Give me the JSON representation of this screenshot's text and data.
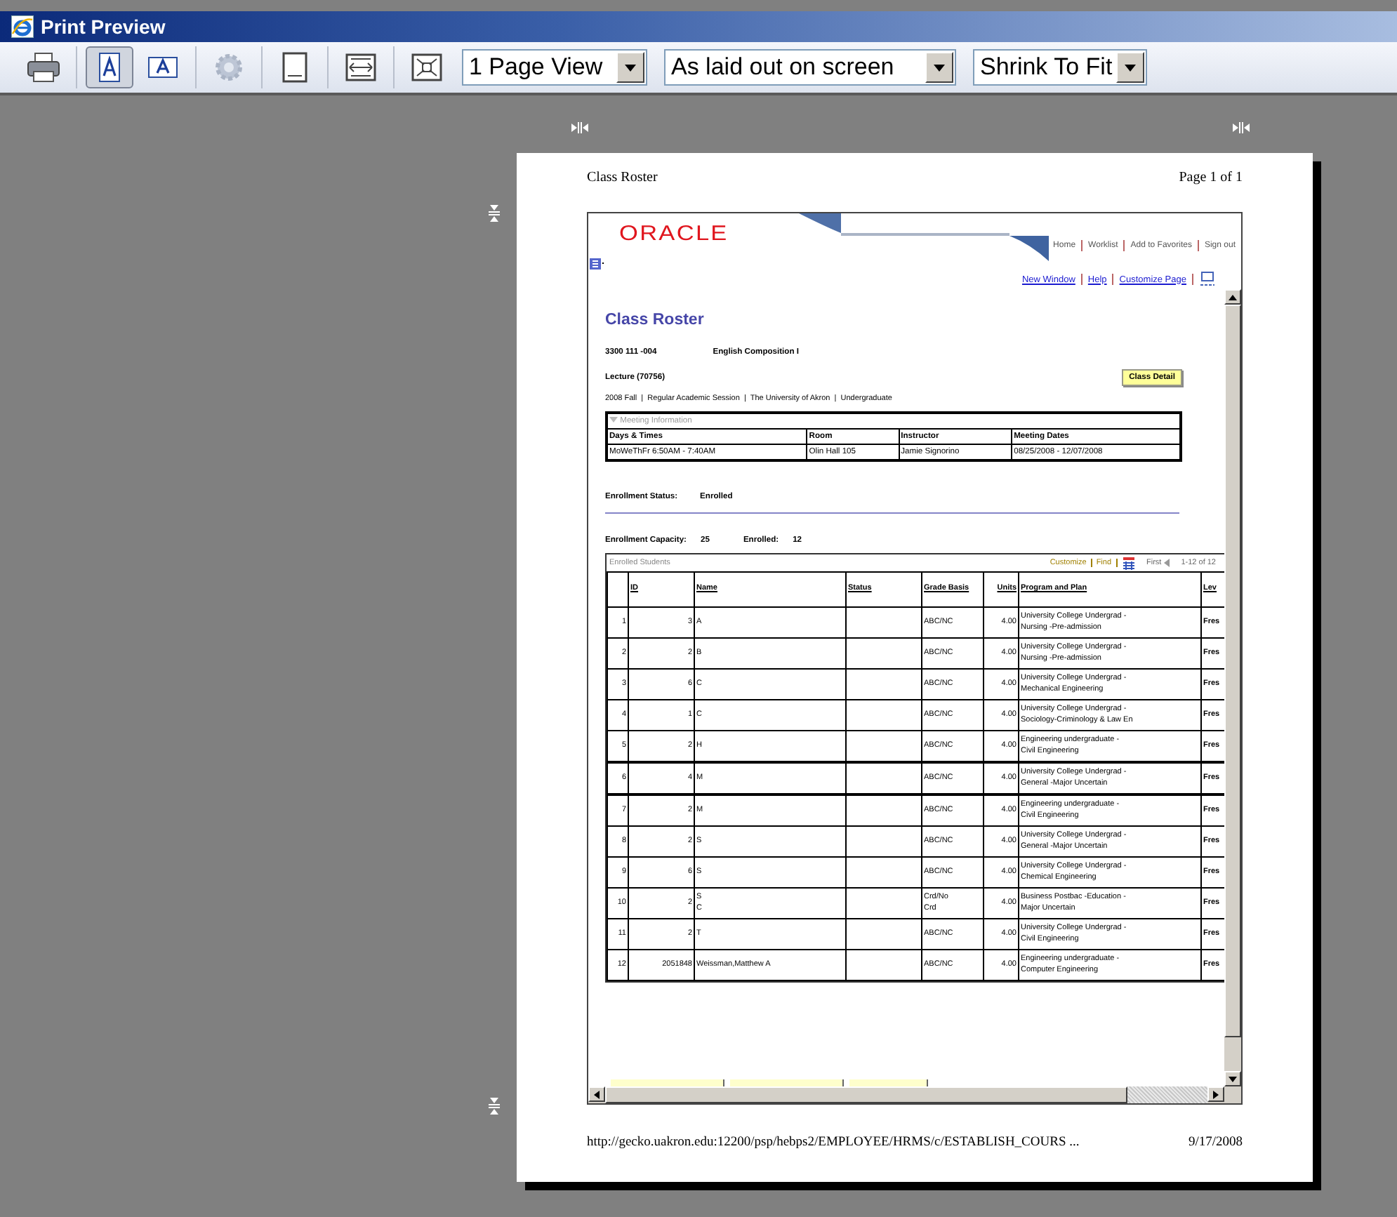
{
  "window": {
    "title": "Print Preview"
  },
  "toolbar": {
    "buttons": [
      {
        "kind": "print",
        "selected": false,
        "disabled": false
      },
      {
        "kind": "portrait",
        "selected": true,
        "disabled": false
      },
      {
        "kind": "landscape",
        "selected": false,
        "disabled": false
      },
      {
        "kind": "setup",
        "selected": false,
        "disabled": true
      },
      {
        "kind": "single-page",
        "selected": false,
        "disabled": false
      },
      {
        "kind": "page-width",
        "selected": false,
        "disabled": false
      },
      {
        "kind": "full-page",
        "selected": false,
        "disabled": false
      }
    ],
    "dropdowns": [
      {
        "value": "1 Page View"
      },
      {
        "value": "As laid out on screen"
      },
      {
        "value": "Shrink To Fit"
      }
    ]
  },
  "page": {
    "header_left": "Class Roster",
    "header_right": "Page 1 of 1",
    "footer_url": "http://gecko.uakron.edu:12200/psp/hebps2/EMPLOYEE/HRMS/c/ESTABLISH_COURS ...",
    "footer_date": "9/17/2008",
    "screen": {
      "logo": "ORACLE",
      "nav": [
        "Home",
        "Worklist",
        "Add to Favorites",
        "Sign out"
      ],
      "links": [
        "New Window",
        "Help",
        "Customize Page"
      ],
      "title": "Class Roster",
      "course_code": "3300 111 -004",
      "course_name": "English Composition I",
      "section": "Lecture (70756)",
      "detail_button": "Class Detail",
      "term_line": "2008 Fall  |  Regular Academic Session  |  The University of Akron  |  Undergraduate",
      "meeting": {
        "title": "Meeting Information",
        "columns": [
          "Days & Times",
          "Room",
          "Instructor",
          "Meeting Dates"
        ],
        "row": [
          "MoWeThFr 6:50AM - 7:40AM",
          "Olin Hall 105",
          "Jamie Signorino",
          "08/25/2008 - 12/07/2008"
        ]
      },
      "status_label": "Enrollment Status:",
      "status_value": "Enrolled",
      "capacity_label": "Enrollment Capacity:",
      "capacity_value": "25",
      "enrolled_label": "Enrolled:",
      "enrolled_value": "12",
      "grid": {
        "title": "Enrolled Students",
        "customize": "Customize",
        "find": "Find",
        "first": "First",
        "range": "1-12 of 12",
        "columns": [
          "ID",
          "Name",
          "Status",
          "Grade Basis",
          "Units",
          "Program and Plan",
          "Lev"
        ],
        "rows": [
          {
            "num": "1",
            "id": "3",
            "name": "A",
            "grade": "ABC/NC",
            "units": "4.00",
            "program": "University College Undergrad -\nNursing -Pre-admission",
            "level": "Fres"
          },
          {
            "num": "2",
            "id": "2",
            "name": "B",
            "grade": "ABC/NC",
            "units": "4.00",
            "program": "University College Undergrad -\nNursing -Pre-admission",
            "level": "Fres"
          },
          {
            "num": "3",
            "id": "6",
            "name": "C",
            "grade": "ABC/NC",
            "units": "4.00",
            "program": "University College Undergrad -\nMechanical Engineering",
            "level": "Fres"
          },
          {
            "num": "4",
            "id": "1",
            "name": "C",
            "grade": "ABC/NC",
            "units": "4.00",
            "program": "University College Undergrad -\nSociology-Criminology & Law En",
            "level": "Fres"
          },
          {
            "num": "5",
            "id": "2",
            "name": "H",
            "grade": "ABC/NC",
            "units": "4.00",
            "program": "Engineering undergraduate -\nCivil Engineering",
            "level": "Fres"
          },
          {
            "num": "6",
            "id": "4",
            "name": "M",
            "grade": "ABC/NC",
            "units": "4.00",
            "program": "University College Undergrad -\nGeneral -Major Uncertain",
            "level": "Fres"
          },
          {
            "num": "7",
            "id": "2",
            "name": "M",
            "grade": "ABC/NC",
            "units": "4.00",
            "program": "Engineering undergraduate -\nCivil Engineering",
            "level": "Fres"
          },
          {
            "num": "8",
            "id": "2",
            "name": "S",
            "grade": "ABC/NC",
            "units": "4.00",
            "program": "University College Undergrad -\nGeneral -Major Uncertain",
            "level": "Fres"
          },
          {
            "num": "9",
            "id": "6",
            "name": "S",
            "grade": "ABC/NC",
            "units": "4.00",
            "program": "University College Undergrad -\nChemical Engineering",
            "level": "Fres"
          },
          {
            "num": "10",
            "id": "2",
            "name": "S\nC",
            "grade": "Crd/No\nCrd",
            "units": "4.00",
            "program": "Business Postbac -Education -\nMajor Uncertain",
            "level": "Fres"
          },
          {
            "num": "11",
            "id": "2",
            "name": "T",
            "grade": "ABC/NC",
            "units": "4.00",
            "program": "University College Undergrad -\nCivil Engineering",
            "level": "Fres"
          },
          {
            "num": "12",
            "id": "2051848",
            "name": "Weissman,Matthew A",
            "grade": "ABC/NC",
            "units": "4.00",
            "program": "Engineering undergraduate -\nComputer Engineering",
            "level": "Fres"
          }
        ]
      }
    }
  }
}
